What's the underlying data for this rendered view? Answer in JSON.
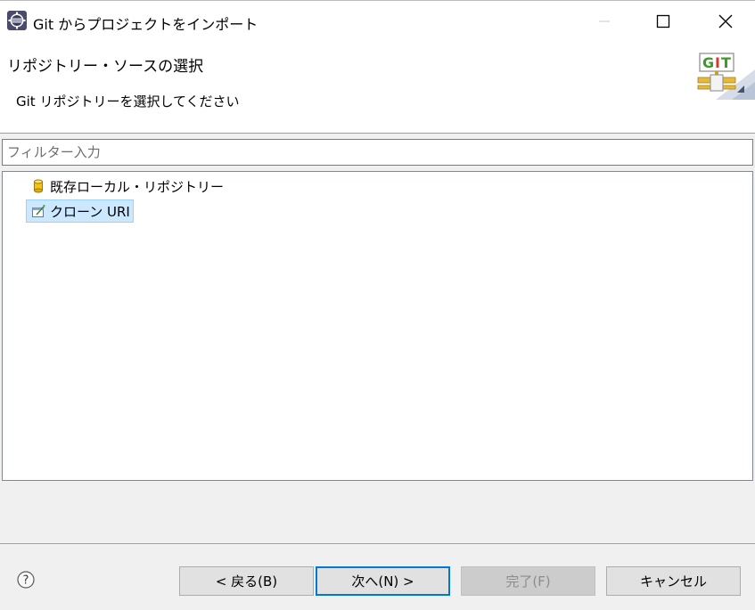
{
  "window": {
    "title": "Git からプロジェクトをインポート",
    "icon": "eclipse-gear-icon"
  },
  "wizard": {
    "title": "リポジトリー・ソースの選択",
    "description": "Git リポジトリーを選択してください",
    "logo_text": "GIT"
  },
  "filter": {
    "placeholder": "フィルター入力",
    "value": ""
  },
  "tree": {
    "items": [
      {
        "label": "既存ローカル・リポジトリー",
        "icon": "repository-cylinder-icon",
        "selected": false
      },
      {
        "label": "クローン URI",
        "icon": "clone-uri-icon",
        "selected": true
      }
    ]
  },
  "buttons": {
    "help": "?",
    "back": "< 戻る(B)",
    "next": "次へ(N) >",
    "finish": "完了(F)",
    "cancel": "キャンセル"
  },
  "colors": {
    "selection_bg": "#cce8ff",
    "default_button_border": "#0078d7",
    "logo_green": "#3c9a2a",
    "logo_red": "#d63a2a"
  }
}
